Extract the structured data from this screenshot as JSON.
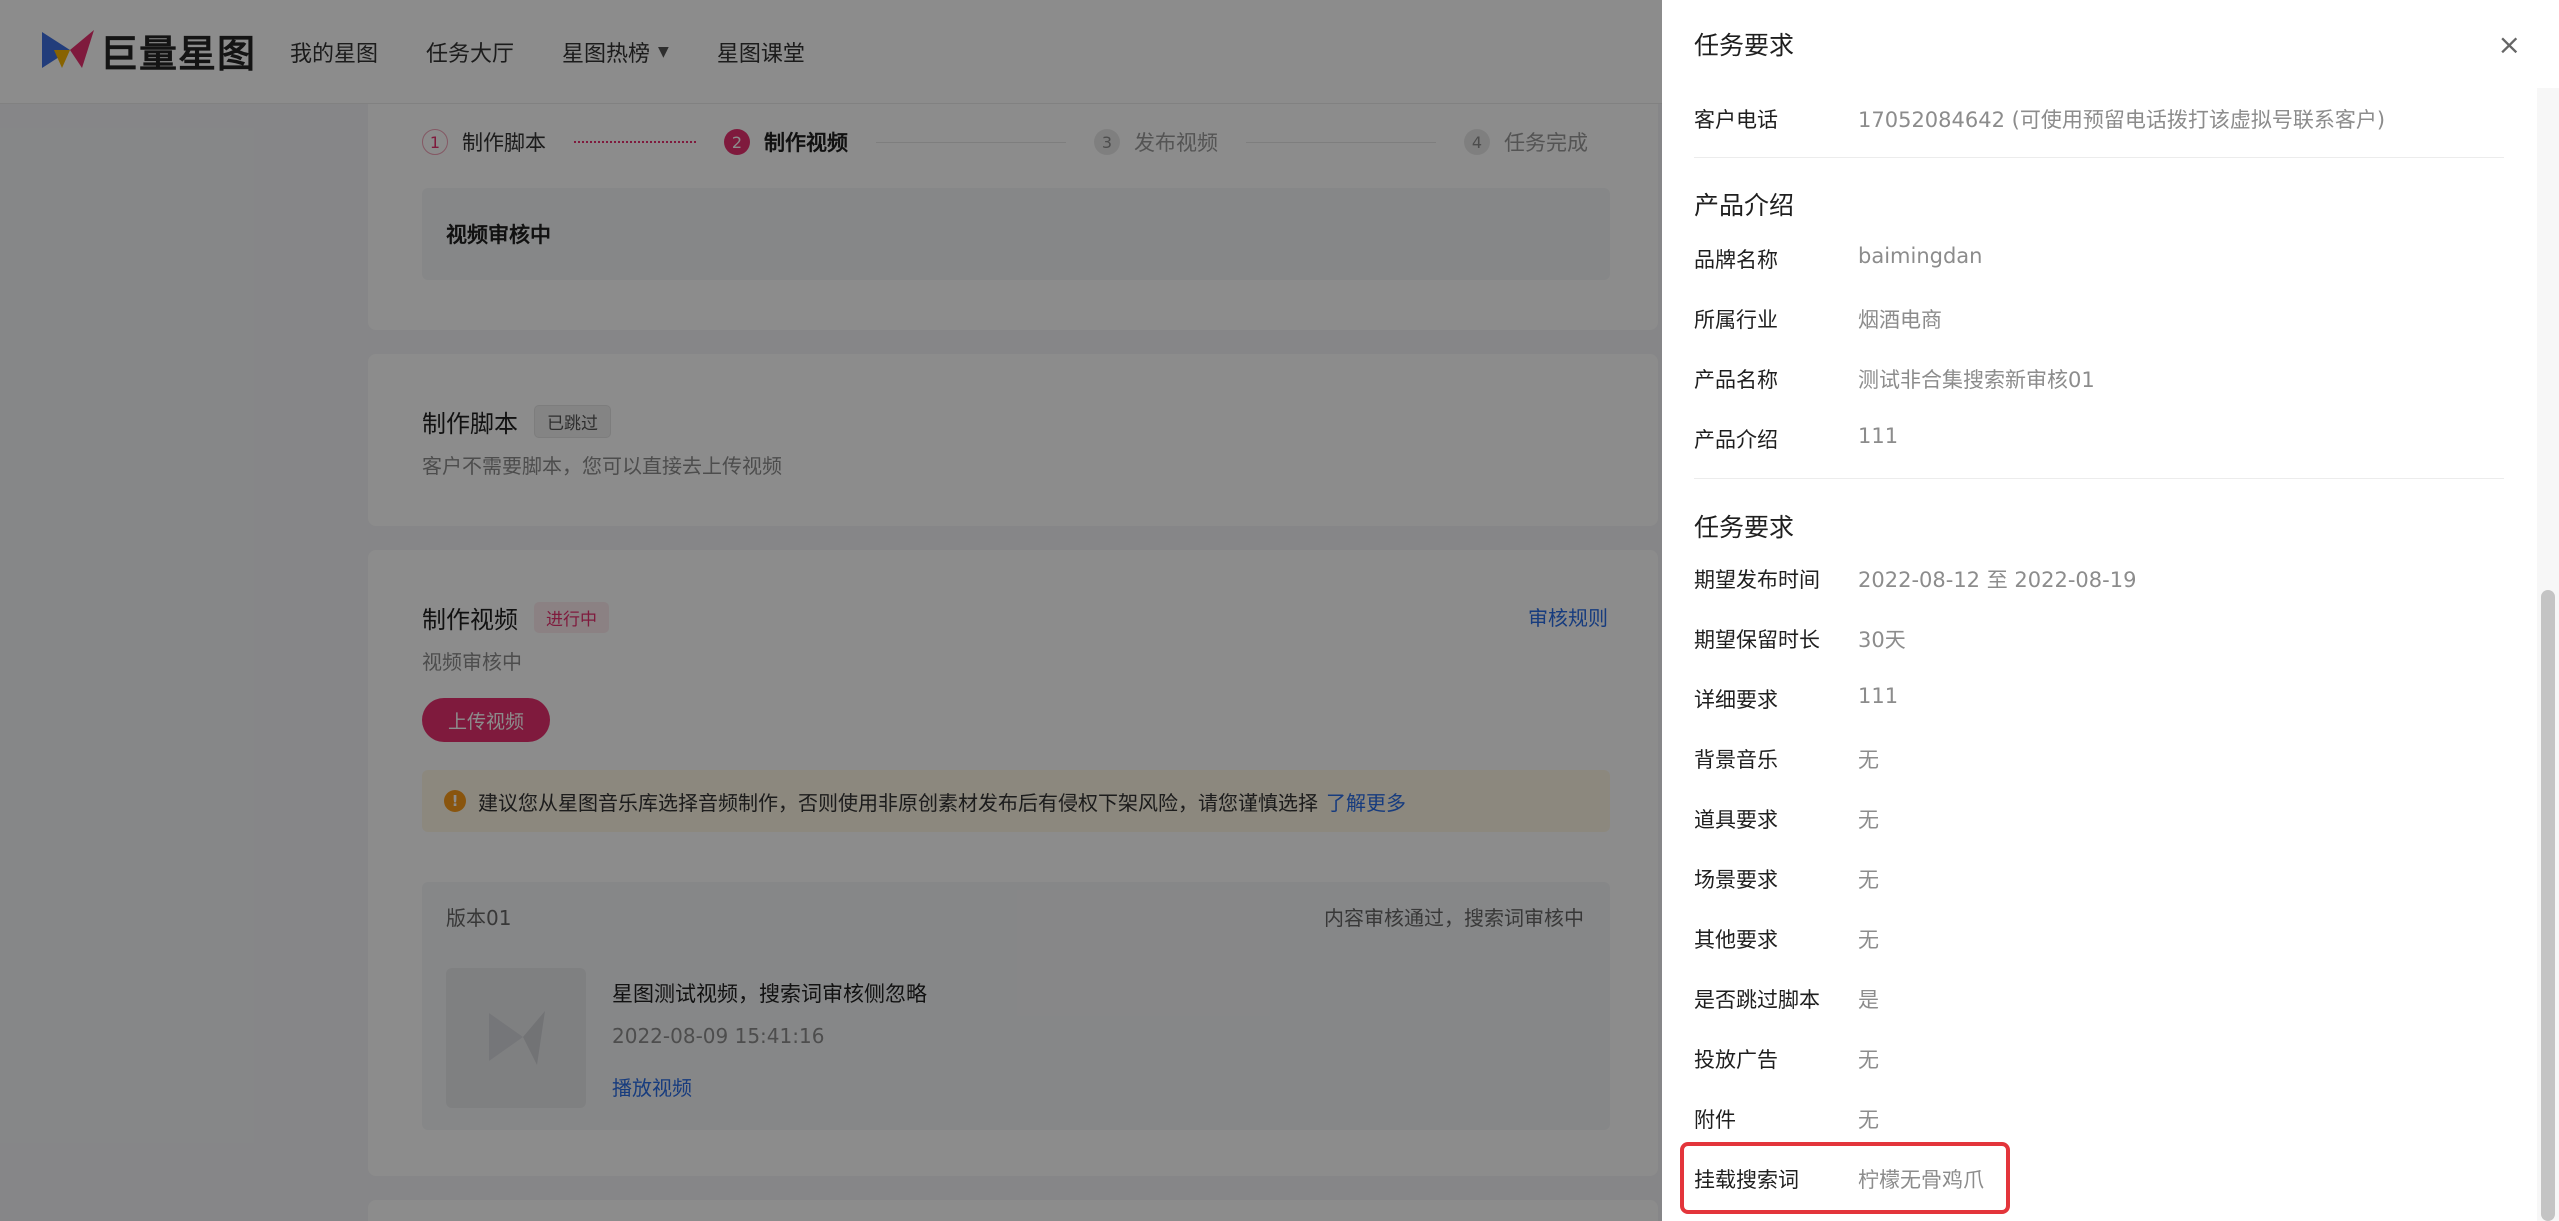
{
  "header": {
    "logo_text": "巨量星图",
    "nav": [
      "我的星图",
      "任务大厅",
      "星图热榜",
      "星图课堂"
    ]
  },
  "steps": [
    {
      "num": "1",
      "label": "制作脚本"
    },
    {
      "num": "2",
      "label": "制作视频"
    },
    {
      "num": "3",
      "label": "发布视频"
    },
    {
      "num": "4",
      "label": "任务完成"
    }
  ],
  "review_status": "视频审核中",
  "script_section": {
    "title": "制作脚本",
    "tag": "已跳过",
    "desc": "客户不需要脚本，您可以直接去上传视频"
  },
  "video_section": {
    "title": "制作视频",
    "tag": "进行中",
    "desc": "视频审核中",
    "rule_link": "审核规则",
    "upload_button": "上传视频",
    "notice": "建议您从星图音乐库选择音频制作，否则使用非原创素材发布后有侵权下架风险，请您谨慎选择",
    "notice_link": "了解更多",
    "version": {
      "title": "版本01",
      "status": "内容审核通过，搜索词审核中",
      "video_title": "星图测试视频，搜索词审核侧忽略",
      "time": "2022-08-09 15:41:16",
      "play_link": "播放视频"
    }
  },
  "drawer": {
    "title": "任务要求",
    "close": "×",
    "customer_phone": {
      "label": "客户电话",
      "value": "17052084642 (可使用预留电话拨打该虚拟号联系客户)"
    },
    "product": {
      "title": "产品介绍",
      "rows": [
        {
          "label": "品牌名称",
          "value": "baimingdan"
        },
        {
          "label": "所属行业",
          "value": "烟酒电商"
        },
        {
          "label": "产品名称",
          "value": "测试非合集搜索新审核01"
        },
        {
          "label": "产品介绍",
          "value": "111"
        }
      ]
    },
    "task": {
      "title": "任务要求",
      "rows": [
        {
          "label": "期望发布时间",
          "value": "2022-08-12 至 2022-08-19"
        },
        {
          "label": "期望保留时长",
          "value": "30天"
        },
        {
          "label": "详细要求",
          "value": "111"
        },
        {
          "label": "背景音乐",
          "value": "无"
        },
        {
          "label": "道具要求",
          "value": "无"
        },
        {
          "label": "场景要求",
          "value": "无"
        },
        {
          "label": "其他要求",
          "value": "无"
        },
        {
          "label": "是否跳过脚本",
          "value": "是"
        },
        {
          "label": "投放广告",
          "value": "无"
        },
        {
          "label": "附件",
          "value": "无"
        },
        {
          "label": "挂载搜索词",
          "value": "柠檬无骨鸡爪"
        }
      ]
    }
  },
  "colors": {
    "accent": "#e8306f",
    "link": "#2b6de5",
    "highlight": "#e3353b"
  }
}
